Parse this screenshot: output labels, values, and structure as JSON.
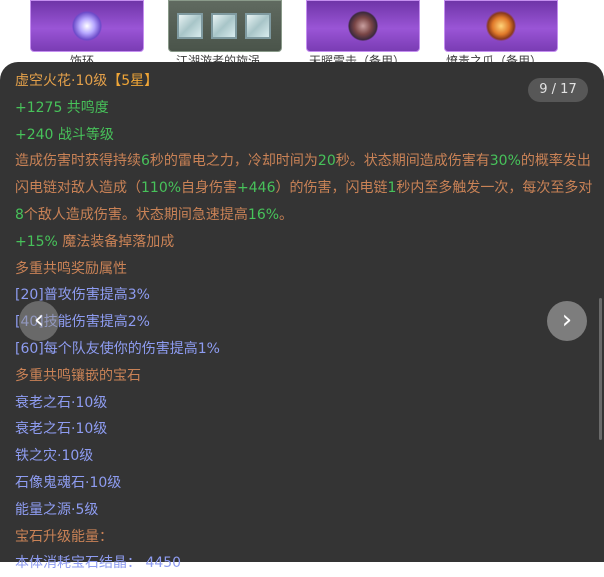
{
  "icons": {
    "items": [
      {
        "caption": "饰环",
        "kind": "orb"
      },
      {
        "caption": "江湖游者的旋涡",
        "kind": "gems"
      },
      {
        "caption": "天曜雷击（备用）",
        "kind": "orb"
      },
      {
        "caption": "燎毒之爪（备用）",
        "kind": "orb"
      }
    ]
  },
  "tooltip": {
    "title_name": "虚空火花·10级",
    "title_stars": "【5星】",
    "counter": "9 / 17",
    "stats": [
      {
        "value": "+1275",
        "label": " 共鸣度"
      },
      {
        "value": "+240",
        "label": " 战斗等级"
      }
    ],
    "description": {
      "parts": [
        {
          "text": "造成伤害时获得持续",
          "color": "brown"
        },
        {
          "text": "6",
          "color": "green"
        },
        {
          "text": "秒的雷电之力，冷却时间为",
          "color": "brown"
        },
        {
          "text": "20",
          "color": "green"
        },
        {
          "text": "秒。状态期间造成伤害有",
          "color": "brown"
        },
        {
          "text": "30%",
          "color": "green"
        },
        {
          "text": "的概率发出闪电链对敌人造成（",
          "color": "brown"
        },
        {
          "text": "110%",
          "color": "green"
        },
        {
          "text": "自身伤害",
          "color": "brown"
        },
        {
          "text": "+446",
          "color": "green"
        },
        {
          "text": "）的伤害，闪电链",
          "color": "brown"
        },
        {
          "text": "1",
          "color": "green"
        },
        {
          "text": "秒内至多触发一次，每次至多对",
          "color": "brown"
        },
        {
          "text": "8",
          "color": "green"
        },
        {
          "text": "个敌人造成伤害。状态期间急速提高",
          "color": "brown"
        },
        {
          "text": "16%",
          "color": "green"
        },
        {
          "text": "。",
          "color": "brown"
        }
      ]
    },
    "drop_bonus": {
      "value": "+15%",
      "label": " 魔法装备掉落加成"
    },
    "resonance_header": "多重共鸣奖励属性",
    "resonance_rewards": [
      "[20]普攻伤害提高3%",
      "[40]技能伤害提高2%",
      "[60]每个队友使你的伤害提高1%"
    ],
    "gems_header": "多重共鸣镶嵌的宝石",
    "gems": [
      "衰老之石·10级",
      "衰老之石·10级",
      "铁之灾·10级",
      "石像鬼魂石·10级",
      "能量之源·5级"
    ],
    "upgrade_header": "宝石升级能量：",
    "upgrade_cost": "本体消耗宝石结晶：  4450"
  },
  "colors": {
    "panel_bg": "#343434",
    "title_orange": "#e3a04a",
    "stars_gold": "#f0a637",
    "value_green": "#47c25a",
    "text_brown": "#c98256",
    "text_blue": "#8e9cf1"
  },
  "nav": {
    "prev_icon": "chevron-left-icon",
    "next_icon": "chevron-right-icon"
  }
}
